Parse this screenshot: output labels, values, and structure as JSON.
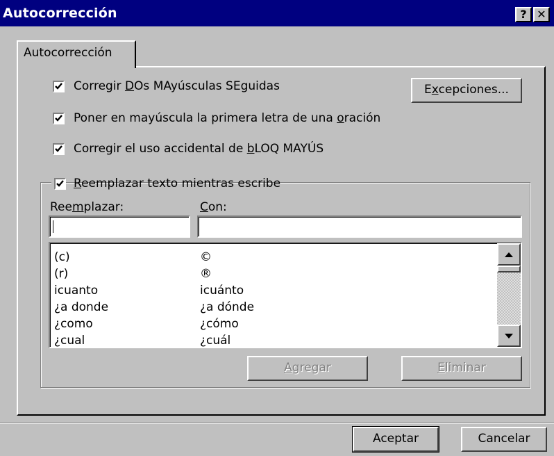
{
  "window": {
    "title": "Autocorrección",
    "help_glyph": "?",
    "close_glyph": "✕"
  },
  "tab": {
    "label": "Autocorrección"
  },
  "options": [
    {
      "pre": "Corregir ",
      "key": "D",
      "post": "Os MAyúsculas SEguidas",
      "checked": true
    },
    {
      "pre": "Poner en mayúscula la primera letra de una ",
      "key": "o",
      "post": "ración",
      "checked": true
    },
    {
      "pre": "Corregir el uso accidental de ",
      "key": "b",
      "post": "LOQ MAYÚS",
      "checked": true
    }
  ],
  "exceptions_button": {
    "pre": "E",
    "key": "x",
    "post": "cepciones..."
  },
  "replace_group": {
    "checkbox": {
      "key": "R",
      "post": "eemplazar texto mientras escribe",
      "checked": true
    },
    "replace_label": {
      "pre": "Ree",
      "key": "m",
      "post": "plazar:"
    },
    "with_label": {
      "key": "C",
      "post": "on:"
    },
    "replace_value": "",
    "with_value": ""
  },
  "entries": [
    {
      "replace": "(c)",
      "with": "©"
    },
    {
      "replace": "(r)",
      "with": "®"
    },
    {
      "replace": "icuanto",
      "with": "icuánto"
    },
    {
      "replace": "¿a donde",
      "with": "¿a dónde"
    },
    {
      "replace": "¿como",
      "with": "¿cómo"
    },
    {
      "replace": "¿cual",
      "with": "¿cuál"
    }
  ],
  "add_button": {
    "key": "A",
    "post": "gregar",
    "enabled": false
  },
  "delete_button": {
    "key": "E",
    "post": "liminar",
    "enabled": false
  },
  "ok_button": {
    "label": "Aceptar"
  },
  "cancel_button": {
    "label": "Cancelar"
  }
}
